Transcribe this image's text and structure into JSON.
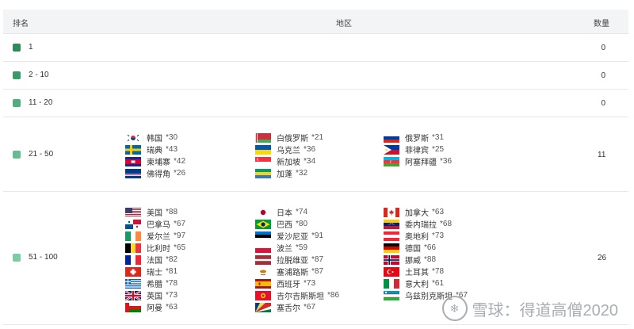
{
  "headers": {
    "rank": "排名",
    "region": "地区",
    "count": "数量"
  },
  "rows": [
    {
      "range": "1",
      "color": "#2e8b57",
      "count": "0"
    },
    {
      "range": "2 - 10",
      "color": "#3a9a68",
      "count": "0"
    },
    {
      "range": "11 - 20",
      "color": "#4fae7e",
      "count": "0"
    },
    {
      "range": "21 - 50",
      "color": "#62be90",
      "count": "11"
    },
    {
      "range": "51 - 100",
      "color": "#7ccca2",
      "count": "26"
    }
  ],
  "group_21_50": [
    [
      {
        "name": "韩国",
        "rank": "*30",
        "flag": "kr"
      },
      {
        "name": "瑞典",
        "rank": "*43",
        "flag": "se"
      },
      {
        "name": "柬埔寨",
        "rank": "*42",
        "flag": "kh"
      },
      {
        "name": "佛得角",
        "rank": "*26",
        "flag": "cv"
      }
    ],
    [
      {
        "name": "白俄罗斯",
        "rank": "*21",
        "flag": "by"
      },
      {
        "name": "乌克兰",
        "rank": "*36",
        "flag": "ua"
      },
      {
        "name": "新加坡",
        "rank": "*34",
        "flag": "sg"
      },
      {
        "name": "加蓬",
        "rank": "*32",
        "flag": "ga"
      }
    ],
    [
      {
        "name": "俄罗斯",
        "rank": "*31",
        "flag": "ru"
      },
      {
        "name": "菲律宾",
        "rank": "*25",
        "flag": "ph"
      },
      {
        "name": "阿塞拜疆",
        "rank": "*36",
        "flag": "az"
      }
    ]
  ],
  "group_51_100": [
    [
      {
        "name": "美国",
        "rank": "*88",
        "flag": "us"
      },
      {
        "name": "巴拿马",
        "rank": "*67",
        "flag": "pa"
      },
      {
        "name": "爱尔兰",
        "rank": "*97",
        "flag": "ie"
      },
      {
        "name": "比利时",
        "rank": "*65",
        "flag": "be"
      },
      {
        "name": "法国",
        "rank": "*82",
        "flag": "fr"
      },
      {
        "name": "瑞士",
        "rank": "*81",
        "flag": "ch"
      },
      {
        "name": "希腊",
        "rank": "*78",
        "flag": "gr"
      },
      {
        "name": "英国",
        "rank": "*73",
        "flag": "gb"
      },
      {
        "name": "阿曼",
        "rank": "*63",
        "flag": "om"
      }
    ],
    [
      {
        "name": "日本",
        "rank": "*74",
        "flag": "jp"
      },
      {
        "name": "巴西",
        "rank": "*80",
        "flag": "br"
      },
      {
        "name": "爱沙尼亚",
        "rank": "*91",
        "flag": "ee"
      },
      {
        "name": "波兰",
        "rank": "*59",
        "flag": "pl"
      },
      {
        "name": "拉脱维亚",
        "rank": "*87",
        "flag": "lv"
      },
      {
        "name": "塞浦路斯",
        "rank": "*87",
        "flag": "cy"
      },
      {
        "name": "西班牙",
        "rank": "*73",
        "flag": "es"
      },
      {
        "name": "吉尔吉斯斯坦",
        "rank": "*86",
        "flag": "kg"
      },
      {
        "name": "塞舌尔",
        "rank": "*67",
        "flag": "sc"
      }
    ],
    [
      {
        "name": "加拿大",
        "rank": "*63",
        "flag": "ca"
      },
      {
        "name": "委内瑞拉",
        "rank": "*68",
        "flag": "ve"
      },
      {
        "name": "奥地利",
        "rank": "*73",
        "flag": "at"
      },
      {
        "name": "德国",
        "rank": "*66",
        "flag": "de"
      },
      {
        "name": "挪威",
        "rank": "*88",
        "flag": "no"
      },
      {
        "name": "土耳其",
        "rank": "*78",
        "flag": "tr"
      },
      {
        "name": "意大利",
        "rank": "*61",
        "flag": "it"
      },
      {
        "name": "乌兹别克斯坦",
        "rank": "*67",
        "flag": "uz"
      }
    ]
  ],
  "watermark": {
    "text": "雪球：得道高僧2020"
  }
}
